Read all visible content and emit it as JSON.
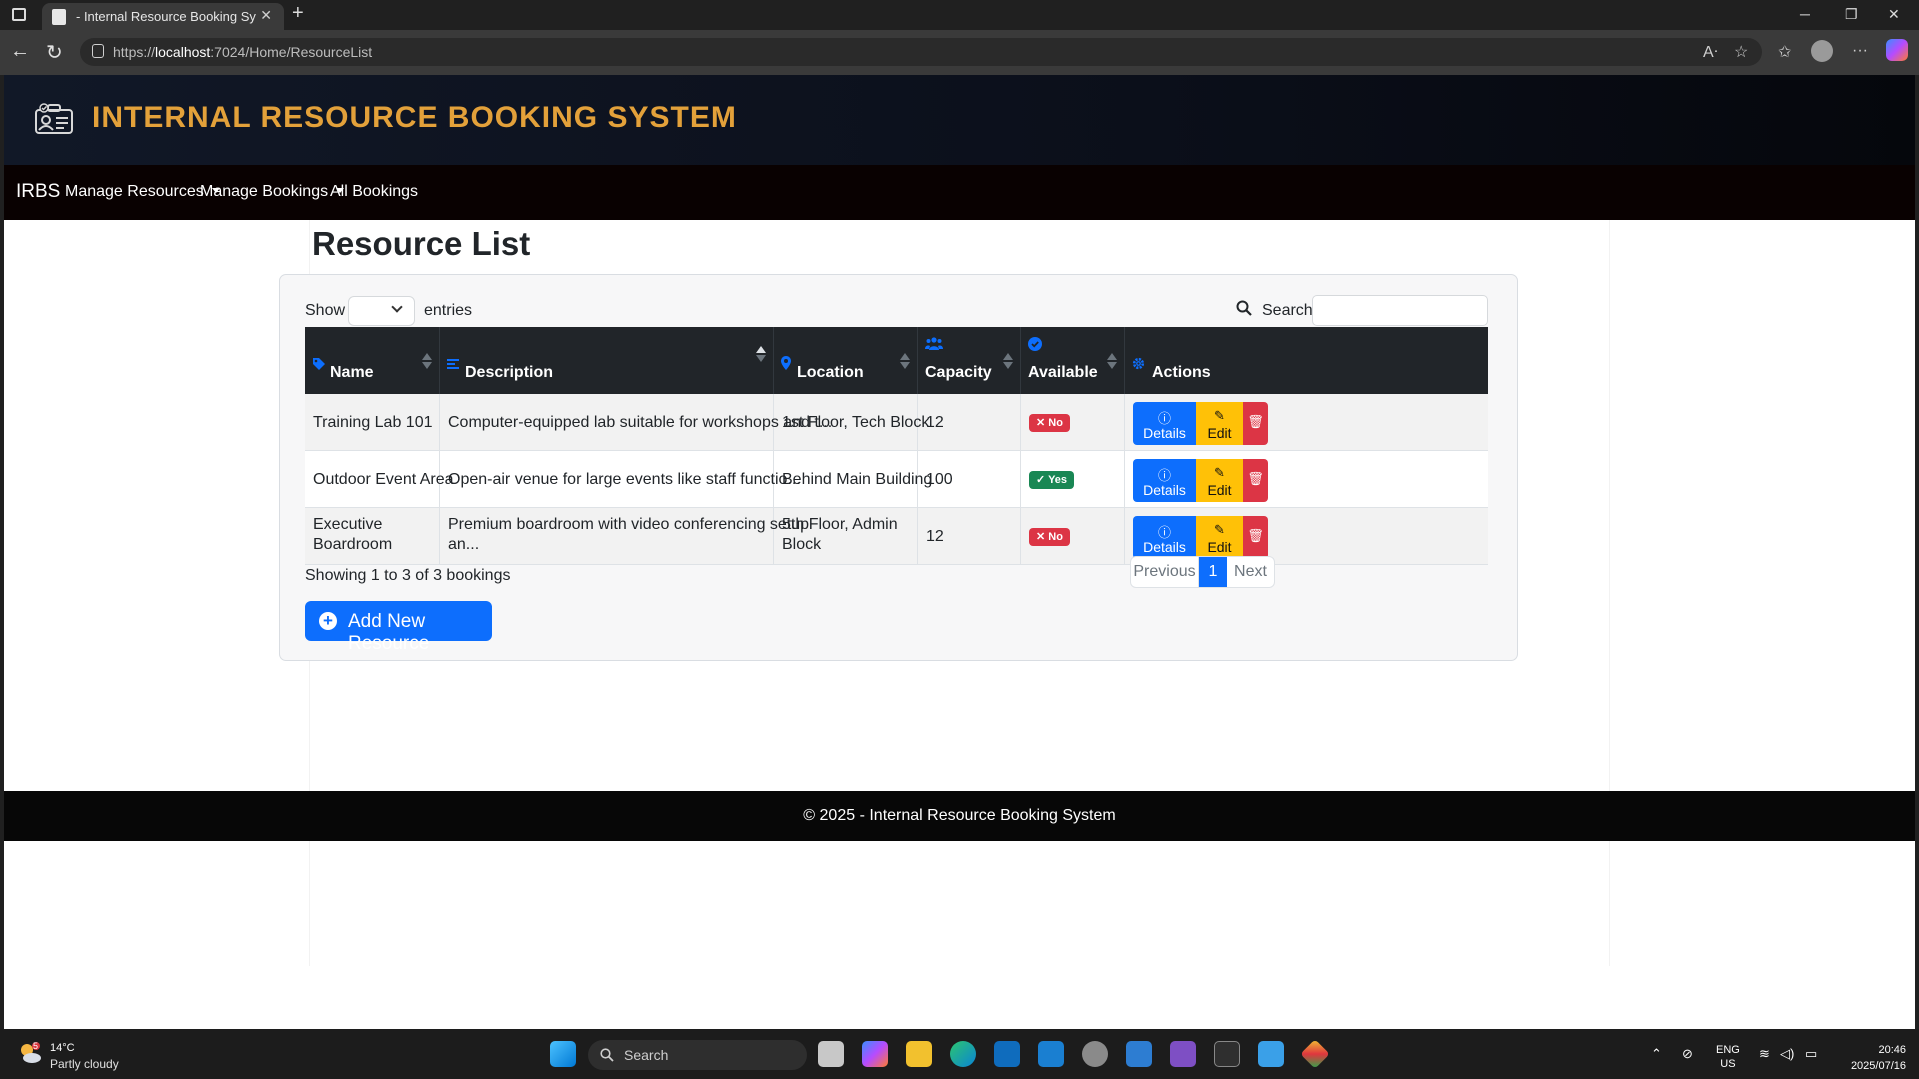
{
  "browser": {
    "tab_title": "- Internal Resource Booking Syste",
    "url_host": "https://localhost",
    "url_path": ":7024/Home/ResourceList",
    "url_host_bold": "localhost"
  },
  "header": {
    "site_title": "INTERNAL RESOURCE BOOKING SYSTEM"
  },
  "navbar": {
    "brand": "IRBS",
    "items": [
      {
        "label": "Manage Resources",
        "dropdown": true
      },
      {
        "label": "Manage Bookings",
        "dropdown": true
      },
      {
        "label": "All Bookings",
        "dropdown": false
      }
    ]
  },
  "page": {
    "title": "Resource List"
  },
  "table_controls": {
    "show_label": "Show",
    "entries_label": "entries",
    "entries_value": "",
    "search_label": "Search:",
    "search_value": ""
  },
  "table": {
    "columns": [
      "Name",
      "Description",
      "Location",
      "Capacity",
      "Available",
      "Actions"
    ],
    "sorted_column": "Description",
    "rows": [
      {
        "name": "Training Lab 101",
        "description": "Computer-equipped lab suitable for workshops and t...",
        "location": "1st Floor, Tech Block",
        "capacity": "12",
        "available": "No"
      },
      {
        "name": "Outdoor Event Area",
        "description": "Open-air venue for large events like staff functio...",
        "location": "Behind Main Building",
        "capacity": "100",
        "available": "Yes"
      },
      {
        "name_line1": "Executive",
        "name_line2": "Boardroom",
        "desc_line1": "Premium boardroom with video conferencing setup",
        "desc_line2": "an...",
        "loc_line1": "5th Floor, Admin",
        "loc_line2": "Block",
        "capacity": "12",
        "available": "No"
      }
    ],
    "actions": {
      "details": "Details",
      "edit": "Edit"
    }
  },
  "pagination": {
    "info": "Showing 1 to 3 of 3 bookings",
    "previous": "Previous",
    "current": "1",
    "next": "Next"
  },
  "add_button": "Add New Resource",
  "footer": "© 2025 - Internal Resource Booking System",
  "taskbar": {
    "weather_temp": "14°C",
    "weather_desc": "Partly cloudy",
    "weather_badge": "5",
    "search": "Search",
    "lang_line1": "ENG",
    "lang_line2": "US",
    "time": "20:46",
    "date": "2025/07/16"
  },
  "colors": {
    "accent": "#0d6efd",
    "title_gold": "#e3a13a",
    "danger": "#dc3545",
    "success": "#198754",
    "warning": "#ffc107"
  }
}
